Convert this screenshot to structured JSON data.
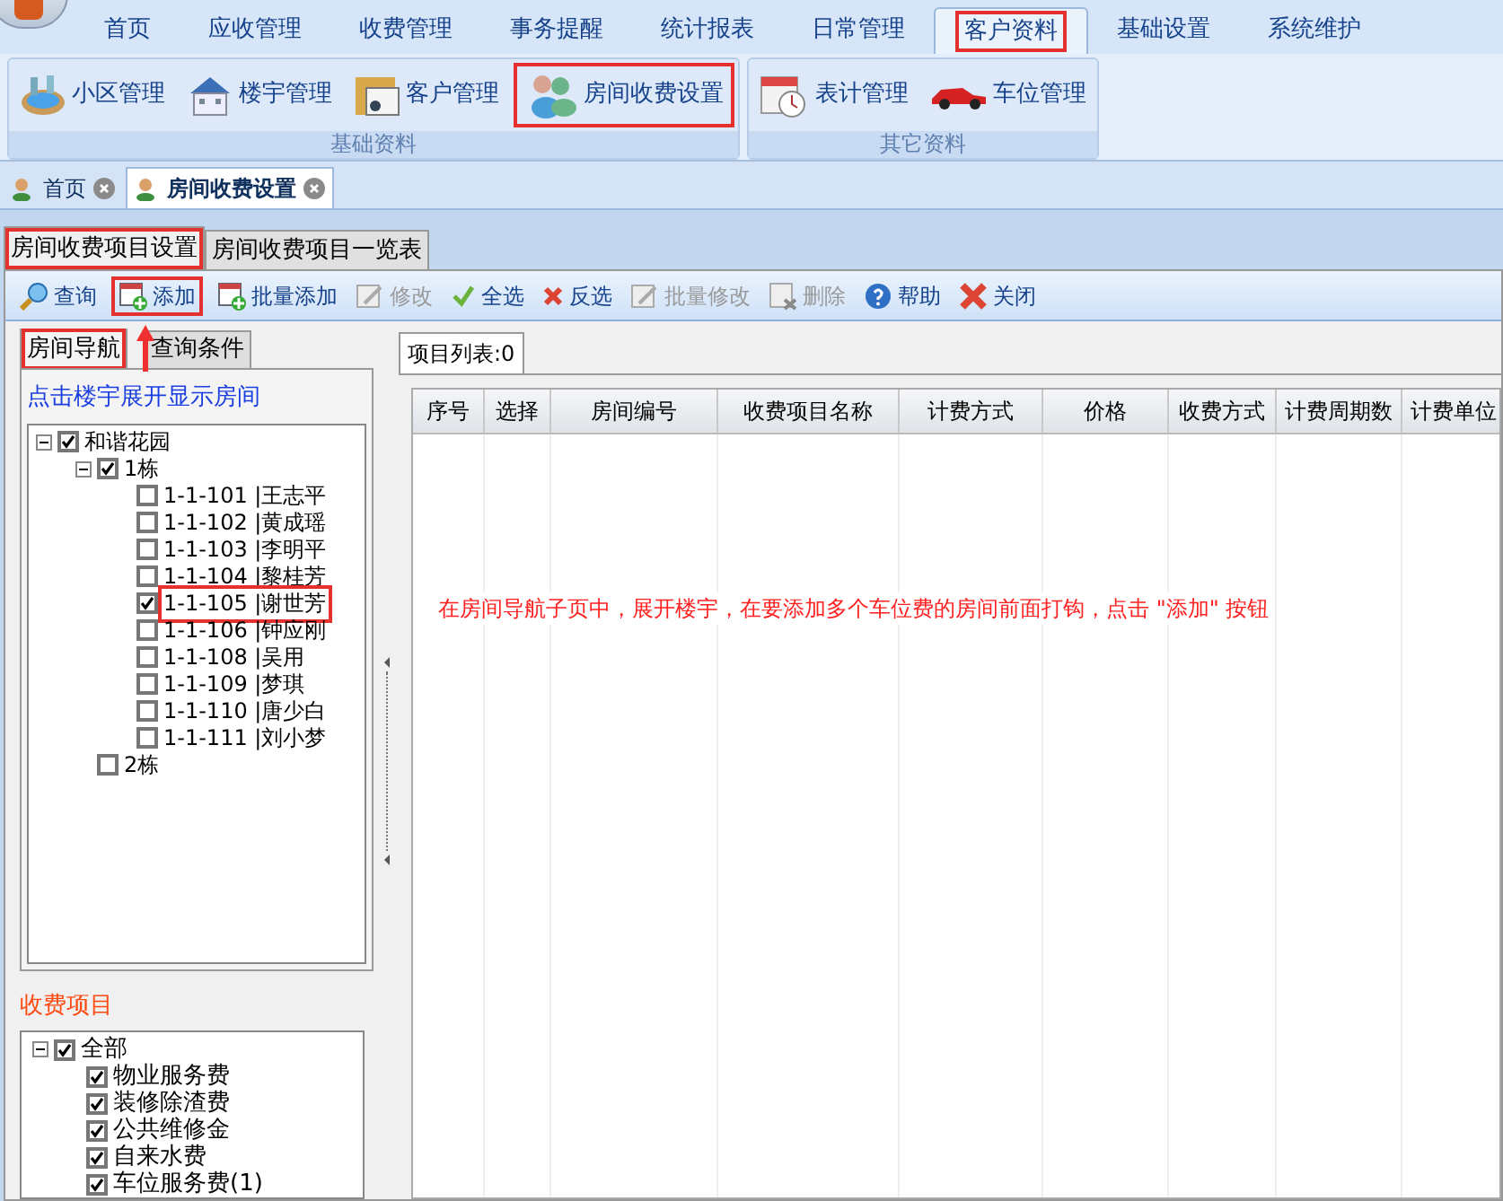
{
  "menu_tabs": [
    {
      "label": "首页",
      "selected": false,
      "highlighted": false
    },
    {
      "label": "应收管理",
      "selected": false,
      "highlighted": false
    },
    {
      "label": "收费管理",
      "selected": false,
      "highlighted": false
    },
    {
      "label": "事务提醒",
      "selected": false,
      "highlighted": false
    },
    {
      "label": "统计报表",
      "selected": false,
      "highlighted": false
    },
    {
      "label": "日常管理",
      "selected": false,
      "highlighted": false
    },
    {
      "label": "客户资料",
      "selected": true,
      "highlighted": true
    },
    {
      "label": "基础设置",
      "selected": false,
      "highlighted": false
    },
    {
      "label": "系统维护",
      "selected": false,
      "highlighted": false
    }
  ],
  "ribbon_groups": [
    {
      "title": "基础资料",
      "items": [
        {
          "label": "小区管理",
          "kind": "pool",
          "highlighted": false
        },
        {
          "label": "楼宇管理",
          "kind": "house",
          "highlighted": false
        },
        {
          "label": "客户管理",
          "kind": "folder",
          "highlighted": false
        },
        {
          "label": "房间收费设置",
          "kind": "people",
          "highlighted": true
        }
      ]
    },
    {
      "title": "其它资料",
      "items": [
        {
          "label": "表计管理",
          "kind": "calendar",
          "highlighted": false
        },
        {
          "label": "车位管理",
          "kind": "car",
          "highlighted": false
        }
      ]
    }
  ],
  "doc_tabs": [
    {
      "label": "首页",
      "selected": false
    },
    {
      "label": "房间收费设置",
      "selected": true
    }
  ],
  "sub_tabs": [
    {
      "label": "房间收费项目设置",
      "selected": true,
      "highlighted": true
    },
    {
      "label": "房间收费项目一览表",
      "selected": false,
      "highlighted": false
    }
  ],
  "toolbar": [
    {
      "label": "查询",
      "kind": "search",
      "disabled": false,
      "highlighted": false
    },
    {
      "label": "添加",
      "kind": "add",
      "disabled": false,
      "highlighted": true
    },
    {
      "label": "批量添加",
      "kind": "add",
      "disabled": false,
      "highlighted": false
    },
    {
      "label": "修改",
      "kind": "edit",
      "disabled": true,
      "highlighted": false
    },
    {
      "label": "全选",
      "kind": "check",
      "disabled": false,
      "highlighted": false
    },
    {
      "label": "反选",
      "kind": "cross",
      "disabled": false,
      "highlighted": false
    },
    {
      "label": "批量修改",
      "kind": "edit",
      "disabled": true,
      "highlighted": false
    },
    {
      "label": "删除",
      "kind": "delete",
      "disabled": true,
      "highlighted": false
    },
    {
      "label": "帮助",
      "kind": "help",
      "disabled": false,
      "highlighted": false
    },
    {
      "label": "关闭",
      "kind": "close",
      "disabled": false,
      "highlighted": false
    }
  ],
  "left_tabs": [
    {
      "label": "房间导航",
      "selected": true,
      "highlighted": true
    },
    {
      "label": "查询条件",
      "selected": false,
      "highlighted": false
    }
  ],
  "nav_hint": "点击楼宇展开显示房间",
  "room_tree": [
    {
      "label": "和谐花园",
      "checked": true,
      "expanded": true,
      "children": [
        {
          "label": "1栋",
          "checked": true,
          "expanded": true,
          "children": [
            {
              "label": "1-1-101 |王志平",
              "checked": false
            },
            {
              "label": "1-1-102 |黄成瑶",
              "checked": false
            },
            {
              "label": "1-1-103 |李明平",
              "checked": false
            },
            {
              "label": "1-1-104 |黎桂芳",
              "checked": false
            },
            {
              "label": "1-1-105 |谢世芳",
              "checked": true,
              "highlighted": true
            },
            {
              "label": "1-1-106 |钟应刚",
              "checked": false
            },
            {
              "label": "1-1-108 |吴用",
              "checked": false
            },
            {
              "label": "1-1-109 |梦琪",
              "checked": false
            },
            {
              "label": "1-1-110 |唐少白",
              "checked": false
            },
            {
              "label": "1-1-111 |刘小梦",
              "checked": false
            }
          ]
        },
        {
          "label": "2栋",
          "checked": false
        }
      ]
    }
  ],
  "fee_title": "收费项目",
  "fee_tree": [
    {
      "label": "全部",
      "checked": true,
      "expanded": true,
      "children": [
        {
          "label": "物业服务费",
          "checked": true
        },
        {
          "label": "装修除渣费",
          "checked": true
        },
        {
          "label": "公共维修金",
          "checked": true
        },
        {
          "label": "自来水费",
          "checked": true
        },
        {
          "label": "车位服务费(1)",
          "checked": true
        }
      ]
    }
  ],
  "list_tab": {
    "label": "项目列表:0",
    "selected": true
  },
  "table": {
    "columns": [
      "序号",
      "选择",
      "房间编号",
      "收费项目名称",
      "计费方式",
      "价格",
      "收费方式",
      "计费周期数",
      "计费单位"
    ]
  },
  "annotation": "在房间导航子页中，展开楼宇，在要添加多个车位费的房间前面打钩，点击 \"添加\" 按钮"
}
